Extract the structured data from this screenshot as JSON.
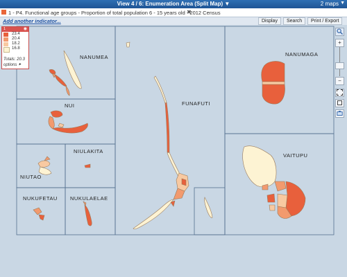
{
  "topbar": {
    "title": "View 4 / 6: Enumeration Area (Split Map)",
    "chevron": "▼",
    "maps_count": "2 maps",
    "menu_chevron": "▼"
  },
  "indicator": {
    "text": "1 - P4. Functional age groups - Proportion of total population 6 - 15 years old - 2012 Census",
    "close": "✖",
    "color": "#e8663a"
  },
  "toolbar": {
    "add_label": "Add another indicator...",
    "display": "Display",
    "search": "Search",
    "print_export": "Print / Export"
  },
  "legend": {
    "header_num": "1",
    "eye": "◉",
    "classes": [
      {
        "value": "23.4",
        "color": "#e8603c"
      },
      {
        "value": "20.4",
        "color": "#f29a6e"
      },
      {
        "value": "18.2",
        "color": "#f8c9a1"
      },
      {
        "value": "16.8",
        "color": "#fdf3d3"
      }
    ],
    "totals": "Totals: 20.3",
    "options": "options ⯈"
  },
  "map": {
    "labels": {
      "nanumea": "NANUMEA",
      "nui": "NUI",
      "niulakita": "NIULAKITA",
      "niutao": "NIUTAO",
      "nukufetau": "NUKUFETAU",
      "nukulaelae": "NUKULAELAE",
      "funafuti": "FUNAFUTI",
      "nanumaga": "NANUMAGA",
      "vaitupu": "VAITUPU"
    }
  },
  "zoom": {
    "search_icon": "🔍",
    "plus": "+",
    "minus": "−"
  }
}
